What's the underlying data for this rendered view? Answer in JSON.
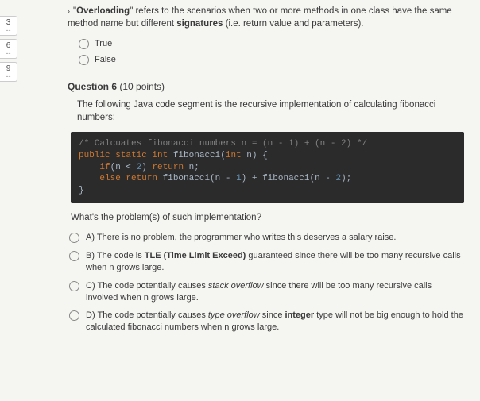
{
  "sidebar": {
    "items": [
      {
        "num": "3",
        "sep": "--"
      },
      {
        "num": "6",
        "sep": "--"
      },
      {
        "num": "9",
        "sep": "--"
      }
    ]
  },
  "q5": {
    "caret": "›",
    "prompt_pre": "\"",
    "prompt_bold1": "Overloading",
    "prompt_mid": "\" refers to the scenarios when two or more methods in one class have the same method name but different ",
    "prompt_bold2": "signatures",
    "prompt_post": " (i.e. return value and parameters).",
    "opt_true": "True",
    "opt_false": "False"
  },
  "q6": {
    "heading_label": "Question 6",
    "heading_points": " (10 points)",
    "prompt": "The following Java code segment is the recursive implementation of calculating fibonacci numbers:",
    "code": {
      "l1_comment": "/* Calcuates fibonacci numbers n = (n - 1) + (n - 2) */",
      "l2_a": "public static ",
      "l2_b": "int",
      "l2_c": " fibonacci(",
      "l2_d": "int",
      "l2_e": " n) {",
      "l3_a": "    if",
      "l3_b": "(n < ",
      "l3_c": "2",
      "l3_d": ") ",
      "l3_e": "return",
      "l3_f": " n;",
      "l4_a": "    else return",
      "l4_b": " fibonacci(n - ",
      "l4_c": "1",
      "l4_d": ") + fibonacci(n - ",
      "l4_e": "2",
      "l4_f": ");",
      "l5": "}"
    },
    "subprompt": "What's the problem(s) of such implementation?",
    "options": {
      "a_label": "A) ",
      "a_text": "There is no problem, the programmer who writes this deserves a salary raise.",
      "b_label": "B) ",
      "b_pre": "The code is ",
      "b_bold": "TLE (Time Limit Exceed)",
      "b_post": " guaranteed since there will be too many recursive calls when n grows large.",
      "c_label": "C) ",
      "c_pre": "The code potentially causes ",
      "c_italic": "stack overflow",
      "c_post": " since there will be too many recursive calls involved when n grows large.",
      "d_label": "D) ",
      "d_pre": "The code potentially causes ",
      "d_italic": "type overflow",
      "d_mid": " since ",
      "d_bold": "integer",
      "d_post": " type will not be big enough to hold the calculated fibonacci numbers when n grows large."
    }
  }
}
